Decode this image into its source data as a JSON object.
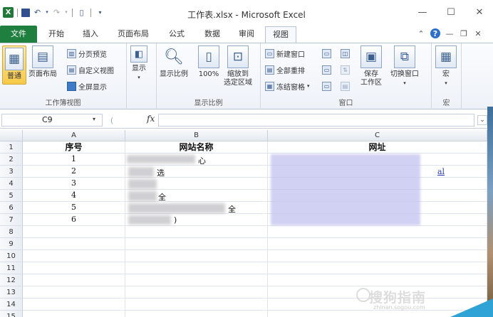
{
  "window": {
    "title": "工作表.xlsx - Microsoft Excel",
    "qat_icons": [
      "excel-logo-icon",
      "save-icon",
      "undo-icon",
      "redo-icon",
      "new-doc-icon",
      "customize-qat-icon"
    ],
    "controls": {
      "minimize": "—",
      "maximize": "☐",
      "close": "✕"
    }
  },
  "tabs": [
    {
      "id": "file",
      "label": "文件"
    },
    {
      "id": "home",
      "label": "开始"
    },
    {
      "id": "insert",
      "label": "插入"
    },
    {
      "id": "layout",
      "label": "页面布局"
    },
    {
      "id": "formula",
      "label": "公式"
    },
    {
      "id": "data",
      "label": "数据"
    },
    {
      "id": "review",
      "label": "审阅"
    },
    {
      "id": "view",
      "label": "视图"
    }
  ],
  "active_tab": "视图",
  "ribbon": {
    "workbook_views": {
      "group_label": "工作簿视图",
      "normal": "普通",
      "page_layout": "页面布局",
      "page_break": "分页预览",
      "custom_views": "自定义视图",
      "full_screen": "全屏显示"
    },
    "show": {
      "label": "显示"
    },
    "zoom": {
      "group_label": "显示比例",
      "zoom_btn": "显示比例",
      "hundred": "100%",
      "zoom_selection_1": "缩放到",
      "zoom_selection_2": "选定区域"
    },
    "window": {
      "group_label": "窗口",
      "new_window": "新建窗口",
      "arrange_all": "全部重排",
      "freeze_panes": "冻结窗格",
      "save_workspace_1": "保存",
      "save_workspace_2": "工作区",
      "switch_windows": "切换窗口"
    },
    "macros": {
      "group_label": "宏",
      "label": "宏"
    }
  },
  "formula_bar": {
    "name_box": "C9",
    "fx_label": "fx",
    "formula": ""
  },
  "sheet": {
    "columns": [
      "A",
      "B",
      "C"
    ],
    "rows": [
      "1",
      "2",
      "3",
      "4",
      "5",
      "6",
      "7",
      "8",
      "9",
      "10",
      "11",
      "12",
      "13",
      "14",
      "15"
    ],
    "headers": {
      "a": "序号",
      "b": "网站名称",
      "c": "网址"
    },
    "seq": [
      "1",
      "2",
      "3",
      "4",
      "5",
      "6"
    ],
    "b_fragments": {
      "r2": "心",
      "r3": "选",
      "r5": "全",
      "r6": "全",
      "r7": ")"
    },
    "c_fragments": {
      "r3": "al"
    },
    "selected_cell": "C9"
  },
  "watermark": {
    "text": "搜狗指南",
    "url": "zhinan.sogou.com"
  },
  "colors": {
    "file_tab": "#1f7f3f",
    "accent_blue": "#2c6fc8",
    "link": "#2a3fb0"
  }
}
